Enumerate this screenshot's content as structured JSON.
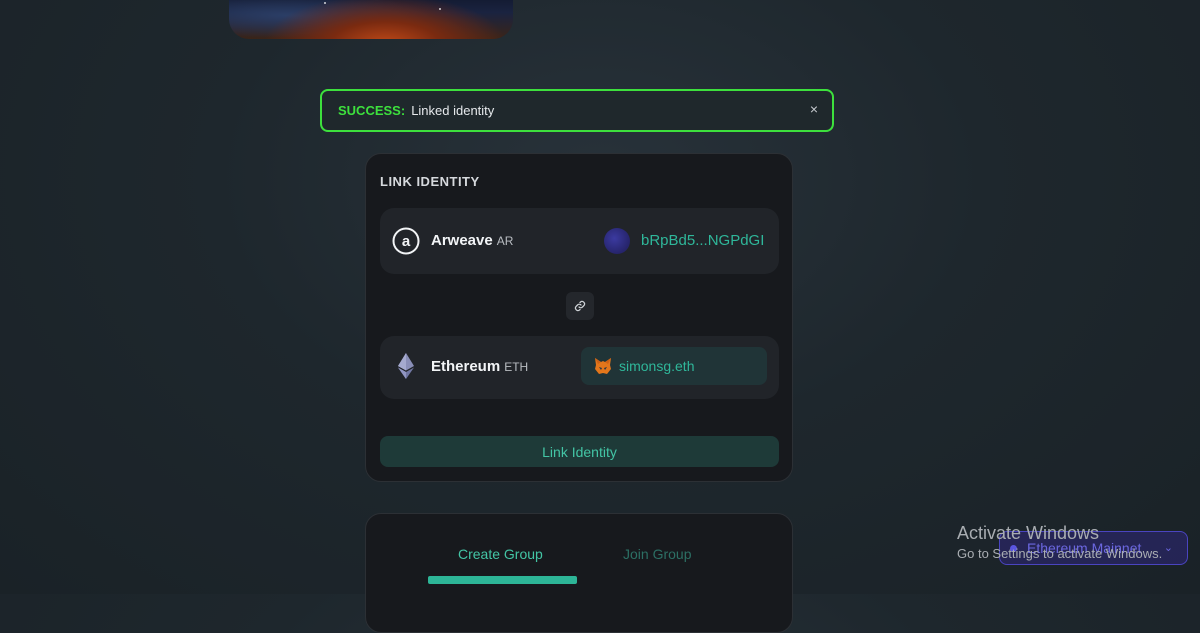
{
  "alert": {
    "label": "SUCCESS:",
    "message": "Linked identity",
    "close": "×",
    "color": "#3de03d"
  },
  "link_identity": {
    "title": "LINK IDENTITY",
    "arweave": {
      "name": "Arweave",
      "ticker": "AR",
      "address": "bRpBd5...NGPdGI",
      "icon": "arweave-icon"
    },
    "link_icon": "link-icon",
    "ethereum": {
      "name": "Ethereum",
      "ticker": "ETH",
      "account": "simonsg.eth",
      "icon": "ethereum-icon",
      "wallet_icon": "metamask-fox-icon"
    },
    "button_label": "Link Identity",
    "accent": "#2fb79a"
  },
  "groups": {
    "tabs": [
      {
        "label": "Create Group",
        "active": true
      },
      {
        "label": "Join Group",
        "active": false
      }
    ]
  },
  "windows_watermark": {
    "title": "Activate Windows",
    "subtitle": "Go to Settings to activate Windows."
  },
  "network": {
    "label": "Ethereum Mainnet",
    "color": "#5a55e0"
  }
}
